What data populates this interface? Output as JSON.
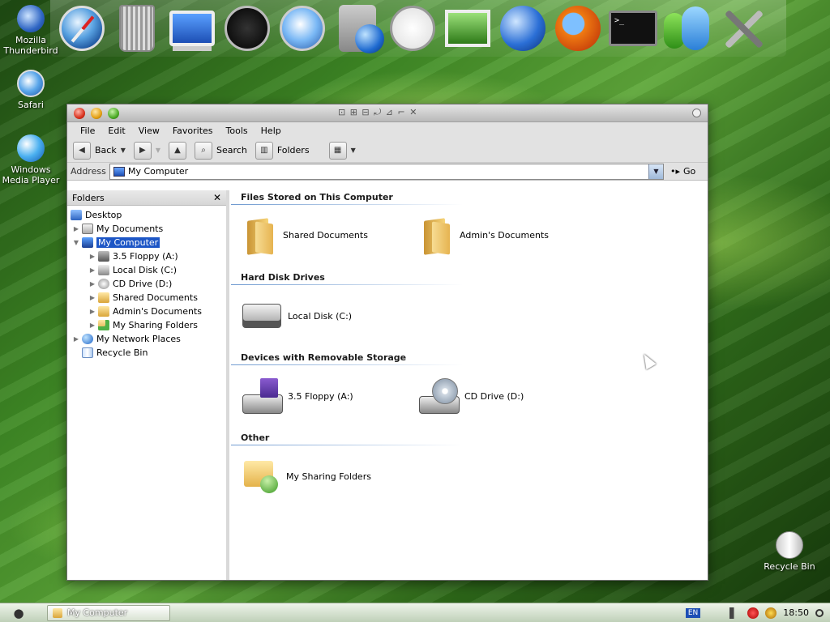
{
  "dock": {
    "items": [
      {
        "name": "safari-compass"
      },
      {
        "name": "trash"
      },
      {
        "name": "imac"
      },
      {
        "name": "dashboard"
      },
      {
        "name": "gauge"
      },
      {
        "name": "network-drive"
      },
      {
        "name": "clock"
      },
      {
        "name": "photo-frame"
      },
      {
        "name": "globe"
      },
      {
        "name": "firefox"
      },
      {
        "name": "terminal",
        "label": ">_"
      },
      {
        "name": "messenger"
      },
      {
        "name": "system-tools"
      }
    ]
  },
  "desktop": {
    "icons": [
      {
        "label": "Mozilla Thunderbird"
      },
      {
        "label": "Safari"
      },
      {
        "label": "Windows Media Player"
      },
      {
        "label": "Recycle Bin"
      }
    ]
  },
  "window": {
    "title_glyphs": "⊡ ⊞ ⊟ ⤾ ⊿ ⌐ ✕",
    "menu": [
      "File",
      "Edit",
      "View",
      "Favorites",
      "Tools",
      "Help"
    ],
    "toolbar": {
      "back": "Back",
      "search": "Search",
      "folders": "Folders"
    },
    "address": {
      "label": "Address",
      "value": "My Computer",
      "go": "Go"
    },
    "folders_pane": {
      "title": "Folders",
      "tree": [
        {
          "label": "Desktop",
          "level": 0,
          "icon": "desktop-icon"
        },
        {
          "label": "My Documents",
          "level": 1,
          "icon": "documents-icon"
        },
        {
          "label": "My Computer",
          "level": 1,
          "icon": "computer-icon",
          "selected": true
        },
        {
          "label": "3.5 Floppy (A:)",
          "level": 2,
          "icon": "floppy-icon"
        },
        {
          "label": "Local Disk (C:)",
          "level": 2,
          "icon": "disk-icon"
        },
        {
          "label": "CD Drive (D:)",
          "level": 2,
          "icon": "cd-icon"
        },
        {
          "label": "Shared Documents",
          "level": 2,
          "icon": "folder-icon"
        },
        {
          "label": "Admin's Documents",
          "level": 2,
          "icon": "folder-icon"
        },
        {
          "label": "My Sharing Folders",
          "level": 2,
          "icon": "sharing-folder-icon"
        },
        {
          "label": "My Network Places",
          "level": 1,
          "icon": "network-icon"
        },
        {
          "label": "Recycle Bin",
          "level": 1,
          "icon": "recycle-bin-icon"
        }
      ]
    },
    "groups": [
      {
        "title": "Files Stored on This Computer",
        "items": [
          {
            "label": "Shared Documents",
            "icon": "folder"
          },
          {
            "label": "Admin's Documents",
            "icon": "folder"
          }
        ]
      },
      {
        "title": "Hard Disk Drives",
        "items": [
          {
            "label": "Local Disk (C:)",
            "icon": "drive"
          }
        ]
      },
      {
        "title": "Devices with Removable Storage",
        "items": [
          {
            "label": "3.5 Floppy (A:)",
            "icon": "floppy"
          },
          {
            "label": "CD Drive (D:)",
            "icon": "cd"
          }
        ]
      },
      {
        "title": "Other",
        "items": [
          {
            "label": "My Sharing Folders",
            "icon": "share"
          }
        ]
      }
    ]
  },
  "taskbar": {
    "task": "My Computer",
    "lang": "EN",
    "clock": "18:50"
  }
}
